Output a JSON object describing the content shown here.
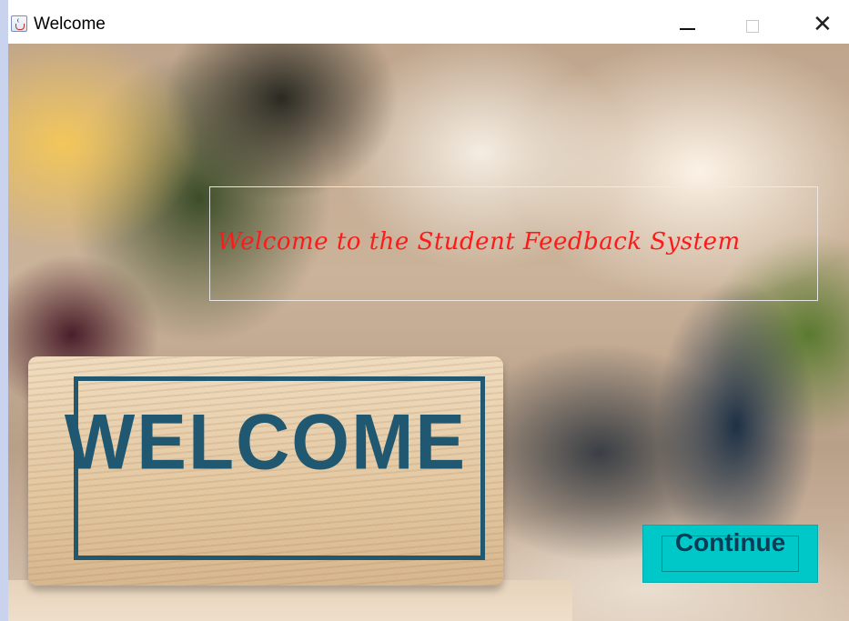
{
  "window": {
    "title": "Welcome",
    "icon": "java-cup-icon",
    "controls": {
      "minimize": "minimize-icon",
      "maximize": "maximize-icon",
      "close": "close-icon"
    }
  },
  "main": {
    "welcome_message": "Welcome to the Student Feedback System",
    "welcome_color": "#ff1a1a",
    "sign_text": "WELCOME",
    "sign_color": "#1f5870",
    "continue_label": "Continue",
    "continue_color": "#00c8c8"
  }
}
